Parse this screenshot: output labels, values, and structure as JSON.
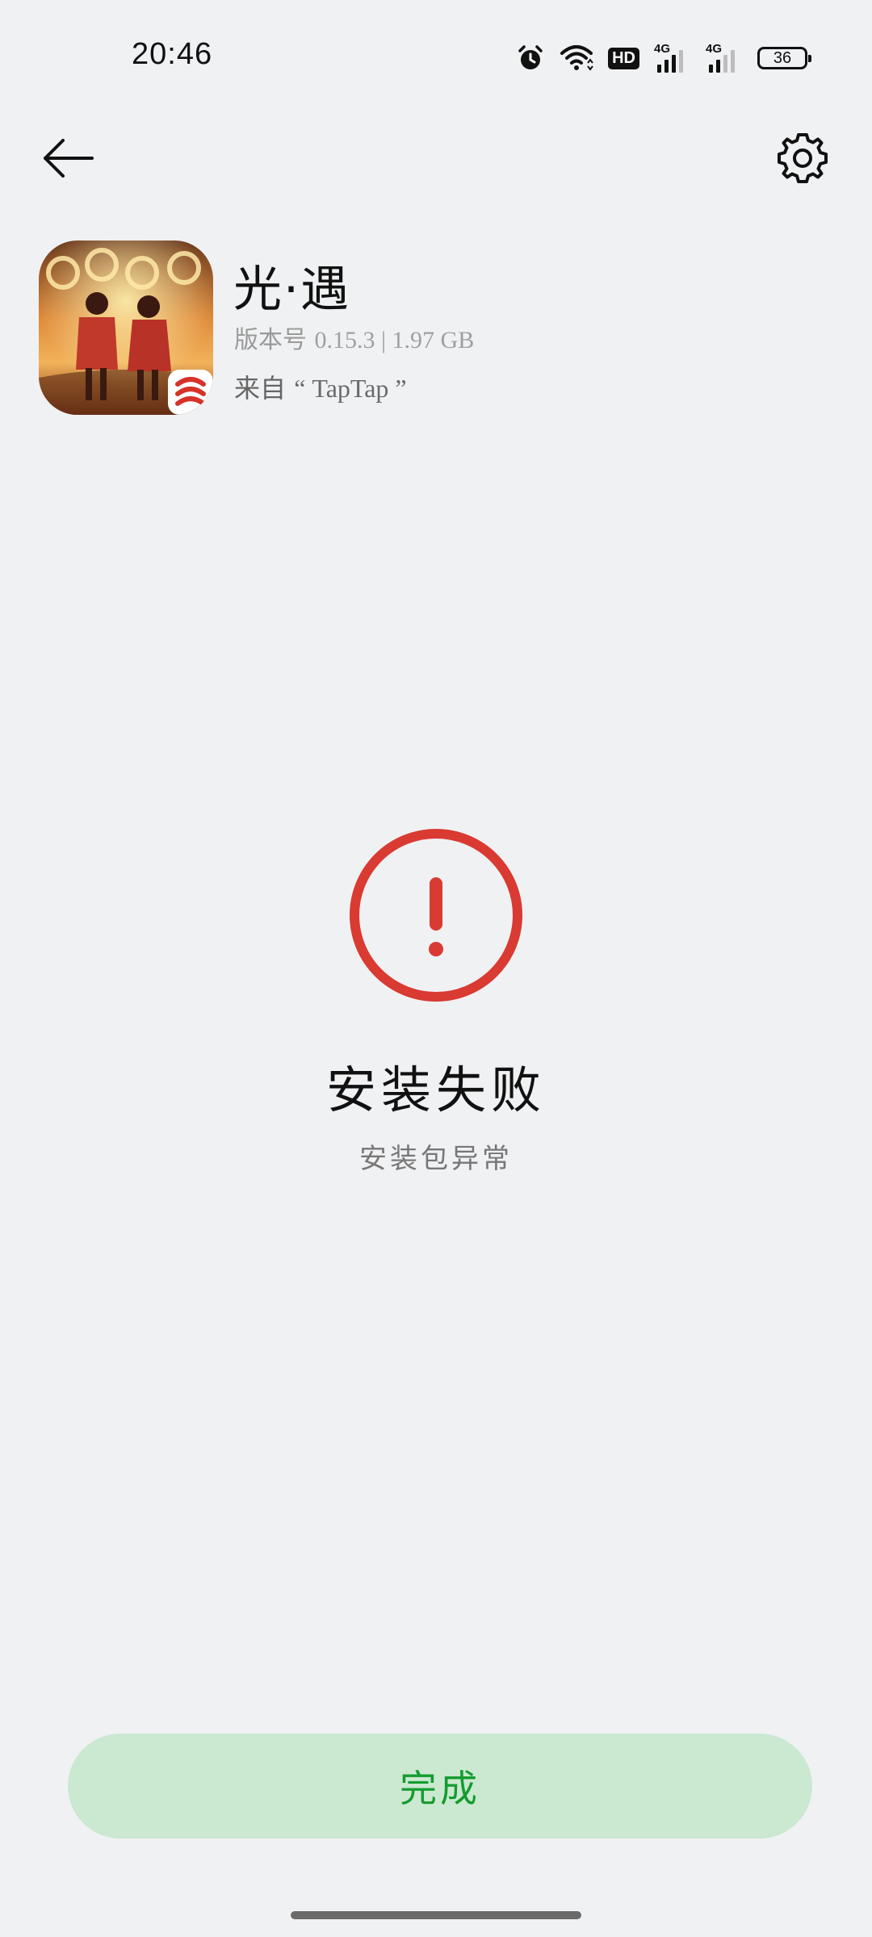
{
  "status_bar": {
    "time": "20:46",
    "hd_label": "HD",
    "network_1": "4G",
    "network_2": "4G",
    "battery_level": "36",
    "icons": [
      "alarm-icon",
      "wifi-icon",
      "hd-icon",
      "signal-4g-icon",
      "signal-4g-icon",
      "battery-icon"
    ]
  },
  "top_bar": {
    "back_icon": "arrow-left-icon",
    "settings_icon": "gear-icon"
  },
  "app": {
    "name": "光·遇",
    "version_label": "版本号",
    "version_value": "0.15.3 | 1.97 GB",
    "source_label": "来自",
    "source_value": "“ TapTap ”"
  },
  "result": {
    "icon": "error-exclamation-icon",
    "title": "安装失败",
    "subtitle": "安装包异常",
    "accent_color": "#d93a32"
  },
  "actions": {
    "done_label": "完成",
    "done_text_color": "#149c2e",
    "done_bg_color": "#cbe8d1"
  }
}
